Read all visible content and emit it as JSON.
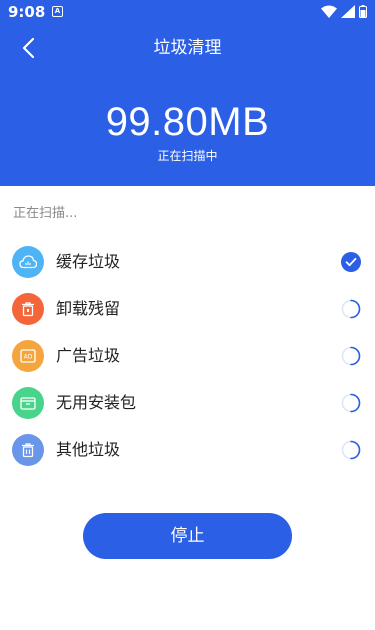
{
  "status_bar": {
    "time": "9:08",
    "notification_badge": "A"
  },
  "header": {
    "title": "垃圾清理",
    "size": "99.80MB",
    "subtitle": "正在扫描中",
    "color": "#2a5fe6"
  },
  "section_label": "正在扫描...",
  "items": [
    {
      "label": "缓存垃圾",
      "icon": "cloud-icon",
      "color": "#4fb4f5",
      "state": "done"
    },
    {
      "label": "卸载残留",
      "icon": "uninstall-trash-icon",
      "color": "#f4663a",
      "state": "scanning"
    },
    {
      "label": "广告垃圾",
      "icon": "ad-icon",
      "color": "#f5a53d",
      "state": "scanning"
    },
    {
      "label": "无用安装包",
      "icon": "package-icon",
      "color": "#48d48a",
      "state": "scanning"
    },
    {
      "label": "其他垃圾",
      "icon": "trash-icon",
      "color": "#6a96ea",
      "state": "scanning"
    }
  ],
  "stop_button": {
    "label": "停止"
  }
}
